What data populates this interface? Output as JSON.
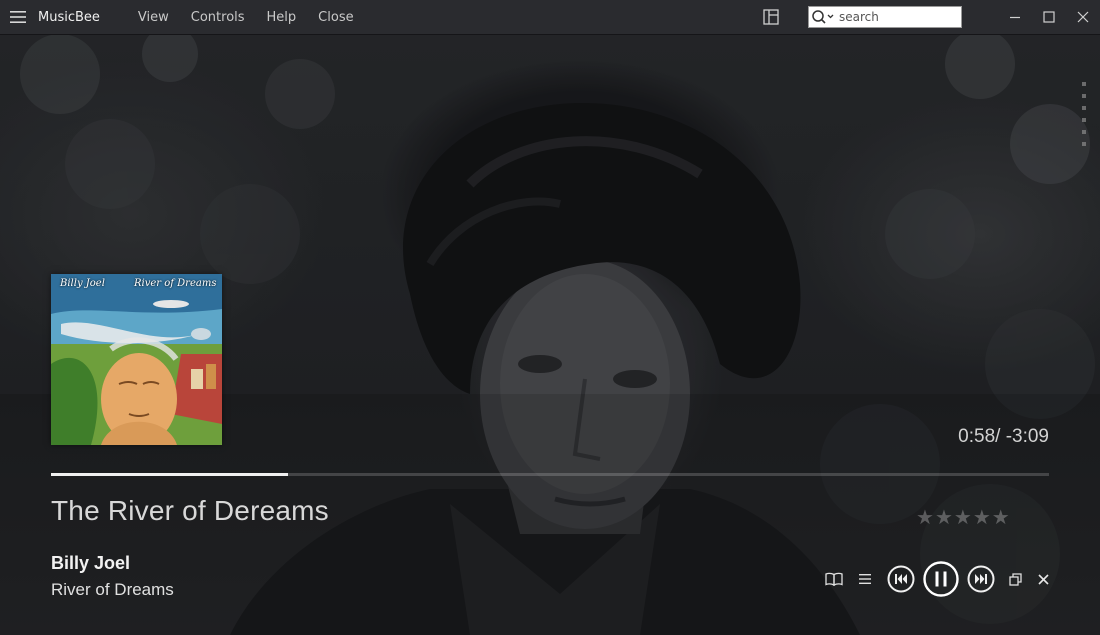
{
  "app": {
    "name": "MusicBee"
  },
  "menu": [
    {
      "label": "View"
    },
    {
      "label": "Controls"
    },
    {
      "label": "Help"
    },
    {
      "label": "Close"
    }
  ],
  "search": {
    "placeholder": "search",
    "value": ""
  },
  "album_art": {
    "artist_text": "Billy Joel",
    "title_text": "River of Dreams"
  },
  "now_playing": {
    "time": "0:58/ -3:09",
    "progress": 0.237,
    "title": "The River of Dereams",
    "artist": "Billy Joel",
    "album": "River of Dreams",
    "rating": 0,
    "rating_max": 5
  },
  "icons": {
    "menu": "hamburger-icon",
    "layout": "layout-panels-icon",
    "search": "search-icon",
    "minimize": "minimize-icon",
    "maximize": "maximize-icon",
    "close": "close-icon",
    "lyrics": "book-icon",
    "list": "list-icon",
    "previous": "previous-track-icon",
    "pause": "pause-icon",
    "next": "next-track-icon",
    "restore": "restore-window-icon",
    "exit": "close-icon"
  },
  "colors": {
    "titlebar": "#2a2b2f",
    "progress_fill": "#f0f0f0",
    "text": "#e6e6e6"
  }
}
